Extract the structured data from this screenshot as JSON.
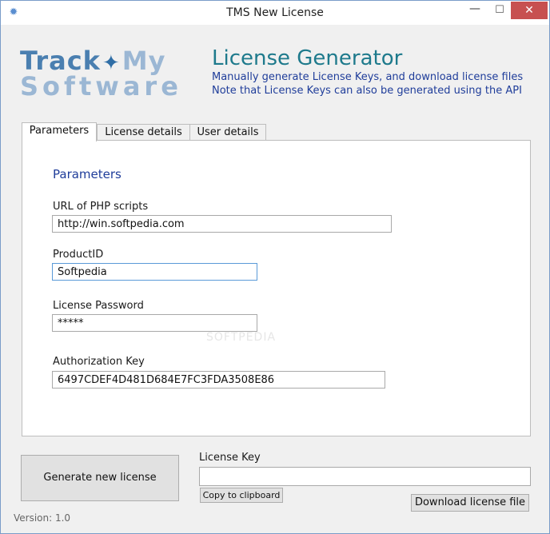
{
  "window": {
    "title": "TMS New License",
    "minimize_glyph": "—",
    "maximize_glyph": "☐",
    "close_glyph": "✕",
    "app_icon": "app-gear-icon"
  },
  "logo": {
    "word1": "Track",
    "word2": "My",
    "word3": "Software",
    "diamond_glyph": "✦"
  },
  "header": {
    "title": "License Generator",
    "line1": "Manually generate License Keys, and download license files",
    "line2": "Note that License Keys can also be generated using the API"
  },
  "tabs": [
    {
      "label": "Parameters",
      "active": true
    },
    {
      "label": "License details",
      "active": false
    },
    {
      "label": "User details",
      "active": false
    }
  ],
  "parameters": {
    "section_title": "Parameters",
    "url_label": "URL of PHP scripts",
    "url_value": "http://win.softpedia.com",
    "product_label": "ProductID",
    "product_value": "Softpedia",
    "password_label": "License Password",
    "password_value": "*****",
    "auth_label": "Authorization Key",
    "auth_value": "6497CDEF4D481D684E7FC3FDA3508E86"
  },
  "bottom": {
    "generate_label": "Generate new license",
    "license_key_label": "License Key",
    "license_key_value": "",
    "copy_label": "Copy to clipboard",
    "download_label": "Download license file",
    "version": "Version: 1.0"
  },
  "watermark": "SOFTPEDIA",
  "colors": {
    "heading": "#1e7a8c",
    "subtitle": "#1f3d9a",
    "close_button": "#c75050",
    "logo_blue": "#4a7fb0",
    "logo_light": "#9bb7d4"
  }
}
